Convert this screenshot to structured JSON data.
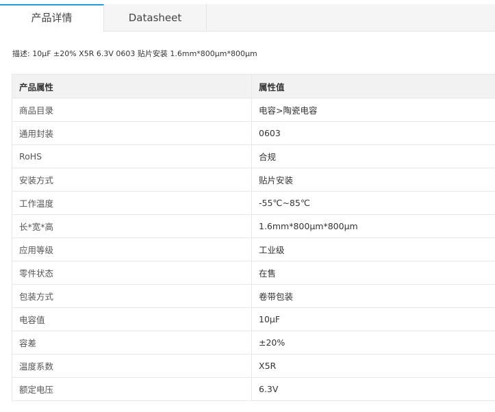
{
  "tabs": [
    {
      "label": "产品详情"
    },
    {
      "label": "Datasheet"
    }
  ],
  "description": "描述: 10μF ±20% X5R 6.3V 0603 贴片安装 1.6mm*800μm*800μm",
  "table": {
    "headers": [
      "产品属性",
      "属性值"
    ],
    "rows": [
      {
        "name": "商品目录",
        "value": "电容>陶瓷电容"
      },
      {
        "name": "通用封装",
        "value": "0603"
      },
      {
        "name": "RoHS",
        "value": "合规"
      },
      {
        "name": "安装方式",
        "value": "贴片安装"
      },
      {
        "name": "工作温度",
        "value": "-55℃~85℃"
      },
      {
        "name": "长*宽*高",
        "value": "1.6mm*800μm*800μm"
      },
      {
        "name": "应用等级",
        "value": "工业级"
      },
      {
        "name": "零件状态",
        "value": "在售"
      },
      {
        "name": "包装方式",
        "value": "卷带包装"
      },
      {
        "name": "电容值",
        "value": "10μF"
      },
      {
        "name": "容差",
        "value": "±20%"
      },
      {
        "name": "温度系数",
        "value": "X5R"
      },
      {
        "name": "额定电压",
        "value": "6.3V"
      }
    ]
  }
}
